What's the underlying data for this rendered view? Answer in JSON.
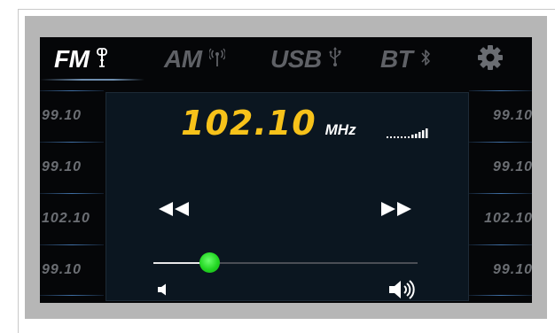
{
  "tabs": [
    {
      "label": "FM",
      "icon": "antenna-icon",
      "active": true
    },
    {
      "label": "AM",
      "icon": "am-antenna-icon",
      "active": false
    },
    {
      "label": "USB",
      "icon": "usb-icon",
      "active": false
    },
    {
      "label": "BT",
      "icon": "bluetooth-icon",
      "active": false
    }
  ],
  "settings_icon": "gear-icon",
  "presets_left": [
    "99.10",
    "99.10",
    "102.10",
    "99.10"
  ],
  "presets_right": [
    "99.10",
    "99.10",
    "102.10",
    "99.10"
  ],
  "station": {
    "frequency": "102.10",
    "unit": "MHz"
  },
  "volume": {
    "level_fraction": 0.21
  },
  "icons": {
    "signal": "signal-strength-icon",
    "seek_back": "rewind-icon",
    "seek_forward": "fast-forward-icon",
    "volume_low": "volume-low-icon",
    "volume_high": "volume-high-icon"
  },
  "colors": {
    "accent_frequency": "#f7c21a",
    "slider_thumb": "#22d622",
    "active_tab": "#ffffff",
    "inactive_tab": "#5f6166",
    "preset_text": "#6b6e73",
    "divider": "#3f6fa5"
  }
}
